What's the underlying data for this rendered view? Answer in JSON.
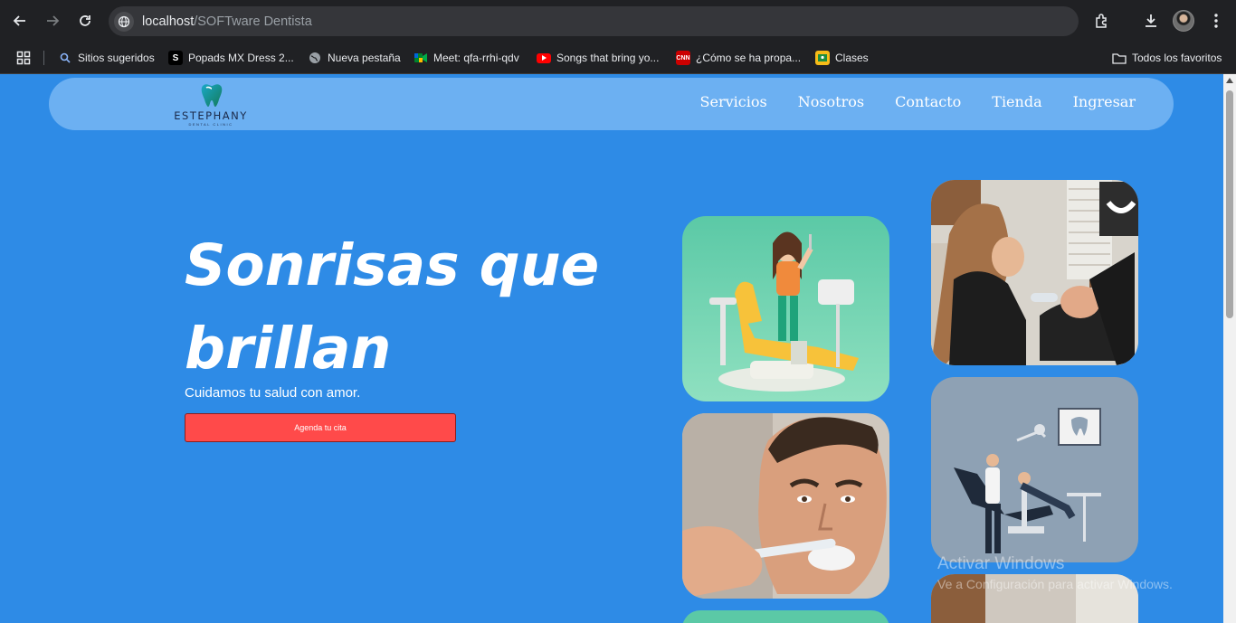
{
  "browser": {
    "url_host": "localhost",
    "url_path": "/SOFTware Dentista",
    "bookmarks": [
      {
        "label": "Sitios sugeridos",
        "icon": "search-icon",
        "color": "#8ab4f8"
      },
      {
        "label": "Popads MX Dress 2...",
        "icon": "s-letter-icon",
        "color": "#000000"
      },
      {
        "label": "Nueva pestaña",
        "icon": "globe-icon",
        "color": "#9aa0a6"
      },
      {
        "label": "Meet: qfa-rrhi-qdv",
        "icon": "meet-icon",
        "color": "#00832d"
      },
      {
        "label": "Songs that bring yo...",
        "icon": "youtube-icon",
        "color": "#ff0000"
      },
      {
        "label": "¿Cómo se ha propa...",
        "icon": "cnn-icon",
        "color": "#cc0000"
      },
      {
        "label": "Clases",
        "icon": "classroom-icon",
        "color": "#f6bb18"
      }
    ],
    "all_favorites": "Todos los favoritos"
  },
  "site": {
    "logo": {
      "name": "ESTEPHANY",
      "sub": "DENTAL CLINIC"
    },
    "nav": [
      "Servicios",
      "Nosotros",
      "Contacto",
      "Tienda",
      "Ingresar"
    ],
    "hero": {
      "title": "Sonrisas que brillan",
      "subtitle": "Cuidamos tu salud con amor.",
      "cta": "Agenda tu cita"
    }
  },
  "watermark": {
    "title": "Activar Windows",
    "subtitle": "Ve a Configuración para activar Windows."
  },
  "colors": {
    "page_bg": "#2e8be6",
    "navbar_bg": "#6cb0f2",
    "cta_bg": "#ff4a4a"
  }
}
